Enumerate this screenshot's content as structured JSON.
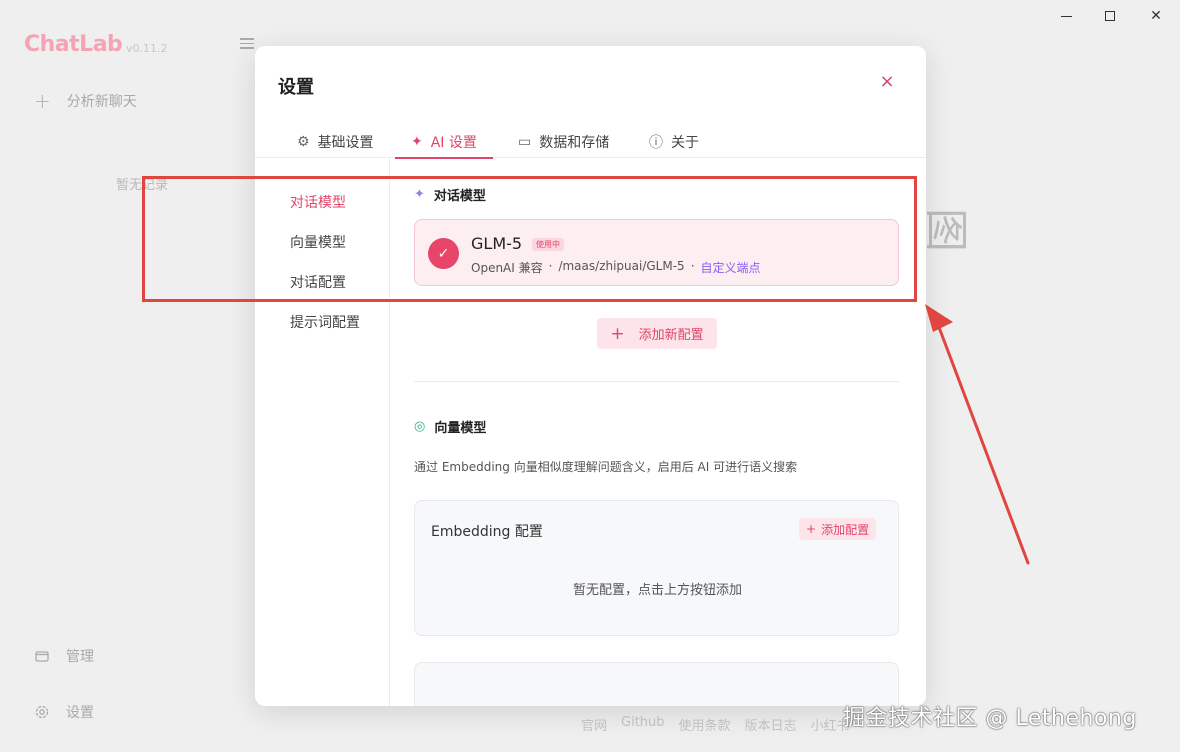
{
  "app": {
    "logo": "ChatLab",
    "version": "v0.11.2",
    "new_chat": "分析新聊天",
    "no_records": "暂无记录",
    "manage": "管理",
    "settings": "设置",
    "footer_links": [
      "官网",
      "Github",
      "使用条款",
      "版本日志",
      "小红书"
    ]
  },
  "window_controls": {
    "minimize": "minimize",
    "maximize": "maximize",
    "close": "✕"
  },
  "modal": {
    "title": "设置",
    "close": "×",
    "tabs": [
      {
        "label": "基础设置",
        "icon": "gear-icon",
        "glyph": "⚙"
      },
      {
        "label": "AI 设置",
        "icon": "sparkle-icon",
        "glyph": "✦"
      },
      {
        "label": "数据和存储",
        "icon": "folder-icon",
        "glyph": "▭"
      },
      {
        "label": "关于",
        "icon": "info-icon",
        "glyph": "ⓘ"
      }
    ],
    "active_tab": "AI 设置",
    "left_nav": [
      "对话模型",
      "向量模型",
      "对话配置",
      "提示词配置"
    ],
    "active_nav": "对话模型",
    "chat_model_section": {
      "title": "对话模型",
      "icon": "sparkle-icon",
      "card": {
        "name": "GLM-5",
        "badge": "使用中",
        "provider": "OpenAI 兼容",
        "sep1": "·",
        "endpoint": "/maas/zhipuai/GLM-5",
        "sep2": "·",
        "custom_link": "自定义端点"
      },
      "add_button": "添加新配置"
    },
    "vector_section": {
      "title": "向量模型",
      "icon": "vector-icon",
      "description": "通过 Embedding 向量相似度理解问题含义，启用后 AI 可进行语义搜索",
      "embed_box": {
        "title": "Embedding 配置",
        "add_label": "添加配置",
        "empty_text": "暂无配置，点击上方按钮添加"
      }
    }
  },
  "watermark": "掘金技术社区 @ Lethehong",
  "colors": {
    "accent": "#e0466b",
    "highlight": "#e0463f",
    "purple_link": "#8b5cf6"
  }
}
